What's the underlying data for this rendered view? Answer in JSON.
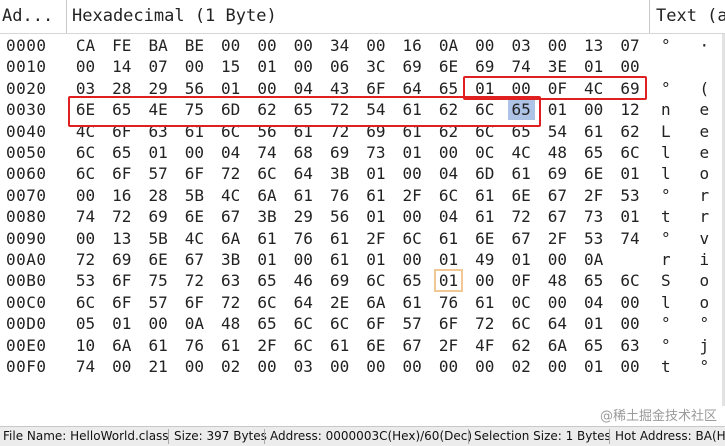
{
  "header": {
    "address_col": "Ad...",
    "hex_col": "Hexadecimal (1 Byte)",
    "text_col": "Text (a"
  },
  "rows": [
    {
      "addr": "0000",
      "hex": [
        "CA",
        "FE",
        "BA",
        "BE",
        "00",
        "00",
        "00",
        "34",
        "00",
        "16",
        "0A",
        "00",
        "03",
        "00",
        "13",
        "07"
      ],
      "text": "°   ·"
    },
    {
      "addr": "0010",
      "hex": [
        "00",
        "14",
        "07",
        "00",
        "15",
        "01",
        "00",
        "06",
        "3C",
        "69",
        "6E",
        "69",
        "74",
        "3E",
        "01",
        "00"
      ],
      "text": ""
    },
    {
      "addr": "0020",
      "hex": [
        "03",
        "28",
        "29",
        "56",
        "01",
        "00",
        "04",
        "43",
        "6F",
        "64",
        "65",
        "01",
        "00",
        "0F",
        "4C",
        "69"
      ],
      "text": "°   ("
    },
    {
      "addr": "0030",
      "hex": [
        "6E",
        "65",
        "4E",
        "75",
        "6D",
        "62",
        "65",
        "72",
        "54",
        "61",
        "62",
        "6C",
        "65",
        "01",
        "00",
        "12"
      ],
      "text": "n   e"
    },
    {
      "addr": "0040",
      "hex": [
        "4C",
        "6F",
        "63",
        "61",
        "6C",
        "56",
        "61",
        "72",
        "69",
        "61",
        "62",
        "6C",
        "65",
        "54",
        "61",
        "62"
      ],
      "text": "L   e"
    },
    {
      "addr": "0050",
      "hex": [
        "6C",
        "65",
        "01",
        "00",
        "04",
        "74",
        "68",
        "69",
        "73",
        "01",
        "00",
        "0C",
        "4C",
        "48",
        "65",
        "6C"
      ],
      "text": "l   e"
    },
    {
      "addr": "0060",
      "hex": [
        "6C",
        "6F",
        "57",
        "6F",
        "72",
        "6C",
        "64",
        "3B",
        "01",
        "00",
        "04",
        "6D",
        "61",
        "69",
        "6E",
        "01"
      ],
      "text": "l   o"
    },
    {
      "addr": "0070",
      "hex": [
        "00",
        "16",
        "28",
        "5B",
        "4C",
        "6A",
        "61",
        "76",
        "61",
        "2F",
        "6C",
        "61",
        "6E",
        "67",
        "2F",
        "53"
      ],
      "text": "°   r"
    },
    {
      "addr": "0080",
      "hex": [
        "74",
        "72",
        "69",
        "6E",
        "67",
        "3B",
        "29",
        "56",
        "01",
        "00",
        "04",
        "61",
        "72",
        "67",
        "73",
        "01"
      ],
      "text": "t   r"
    },
    {
      "addr": "0090",
      "hex": [
        "00",
        "13",
        "5B",
        "4C",
        "6A",
        "61",
        "76",
        "61",
        "2F",
        "6C",
        "61",
        "6E",
        "67",
        "2F",
        "53",
        "74"
      ],
      "text": "°   v"
    },
    {
      "addr": "00A0",
      "hex": [
        "72",
        "69",
        "6E",
        "67",
        "3B",
        "01",
        "00",
        "61",
        "01",
        "00",
        "01",
        "49",
        "01",
        "00",
        "0A"
      ],
      "text": "r   i"
    },
    {
      "addr": "00B0",
      "hex": [
        "53",
        "6F",
        "75",
        "72",
        "63",
        "65",
        "46",
        "69",
        "6C",
        "65",
        "01",
        "00",
        "0F",
        "48",
        "65",
        "6C"
      ],
      "text": "S   o"
    },
    {
      "addr": "00C0",
      "hex": [
        "6C",
        "6F",
        "57",
        "6F",
        "72",
        "6C",
        "64",
        "2E",
        "6A",
        "61",
        "76",
        "61",
        "0C",
        "00",
        "04",
        "00"
      ],
      "text": "l   o"
    },
    {
      "addr": "00D0",
      "hex": [
        "05",
        "01",
        "00",
        "0A",
        "48",
        "65",
        "6C",
        "6C",
        "6F",
        "57",
        "6F",
        "72",
        "6C",
        "64",
        "01",
        "00"
      ],
      "text": "°   °"
    },
    {
      "addr": "00E0",
      "hex": [
        "10",
        "6A",
        "61",
        "76",
        "61",
        "2F",
        "6C",
        "61",
        "6E",
        "67",
        "2F",
        "4F",
        "62",
        "6A",
        "65",
        "63"
      ],
      "text": "°   j"
    },
    {
      "addr": "00F0",
      "hex": [
        "74",
        "00",
        "21",
        "00",
        "02",
        "00",
        "03",
        "00",
        "00",
        "00",
        "00",
        "00",
        "02",
        "00",
        "01",
        "00"
      ],
      "text": "t   °"
    }
  ],
  "watermark": "@稀土掘金技术社区",
  "statusbar": {
    "file": "File Name: HelloWorld.class",
    "size": "Size: 397 Bytes",
    "address": "Address: 0000003C(Hex)/60(Dec)",
    "selection": "Selection Size: 1 Bytes",
    "hot": "Hot Address: BA(He"
  },
  "highlight_color": "#aec4e6",
  "annotation_color": "#e02020",
  "boxed_color": "#f0c896"
}
